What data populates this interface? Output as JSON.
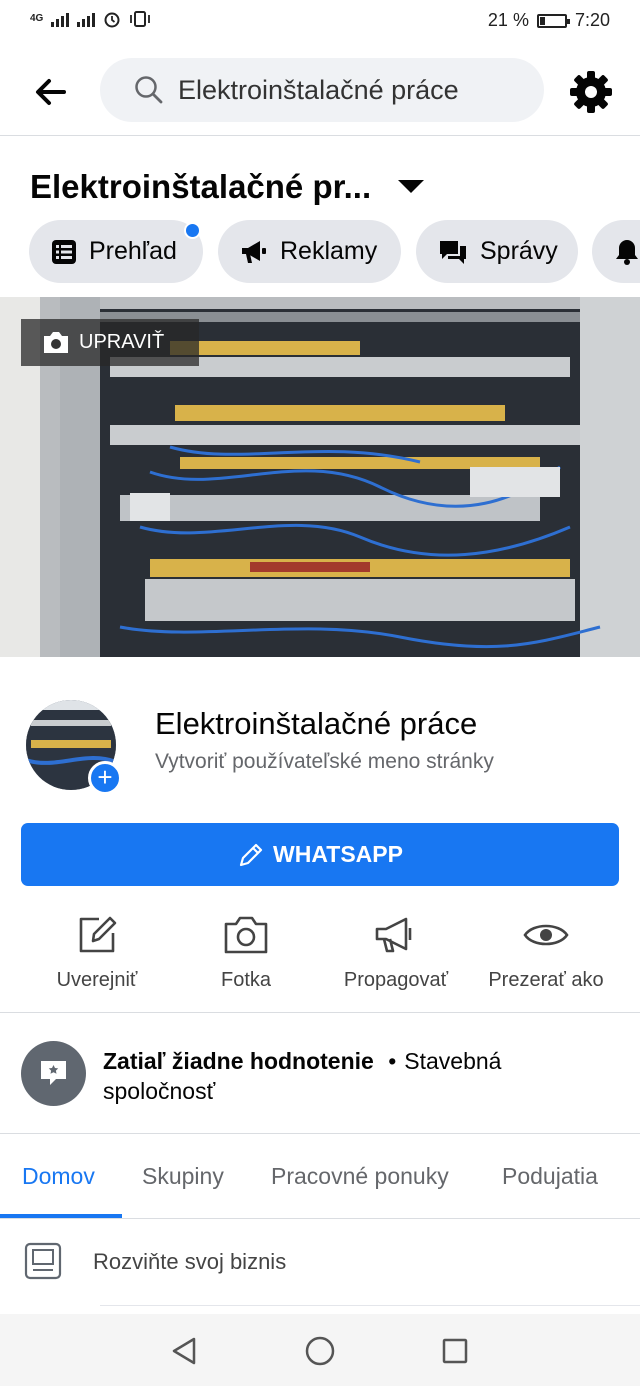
{
  "status_bar": {
    "network_1": "4G",
    "battery_percent": "21 %",
    "battery_level": 0.21,
    "time": "7:20"
  },
  "top_bar": {
    "search_text": "Elektroinštalačné práce"
  },
  "page": {
    "title": "Elektroinštalačné pr...",
    "chips": [
      {
        "label": "Prehľad",
        "icon": "list-icon",
        "has_notification": true
      },
      {
        "label": "Reklamy",
        "icon": "megaphone-icon"
      },
      {
        "label": "Správy",
        "icon": "chat-icon"
      },
      {
        "label": "",
        "icon": "bell-icon"
      }
    ],
    "cover_edit_label": "UPRAVIŤ",
    "name": "Elektroinštalačné práce",
    "username_prompt": "Vytvoriť používateľské meno stránky",
    "primary_button": "WHATSAPP",
    "actions": [
      {
        "label": "Uverejniť",
        "icon": "edit-icon"
      },
      {
        "label": "Fotka",
        "icon": "camera-icon"
      },
      {
        "label": "Propagovať",
        "icon": "megaphone-icon"
      },
      {
        "label": "Prezerať ako",
        "icon": "eye-icon"
      }
    ],
    "rating": {
      "text": "Zatiaľ žiadne hodnotenie",
      "separator": "•",
      "category": "Stavebná spoločnosť"
    },
    "tabs": [
      "Domov",
      "Skupiny",
      "Pracovné ponuky",
      "Podujatia"
    ],
    "active_tab": "Domov",
    "grow_business": "Rozviňte svoj biznis"
  },
  "colors": {
    "accent": "#1877f2",
    "chip_bg": "#e4e6eb",
    "muted_text": "#65676b"
  }
}
